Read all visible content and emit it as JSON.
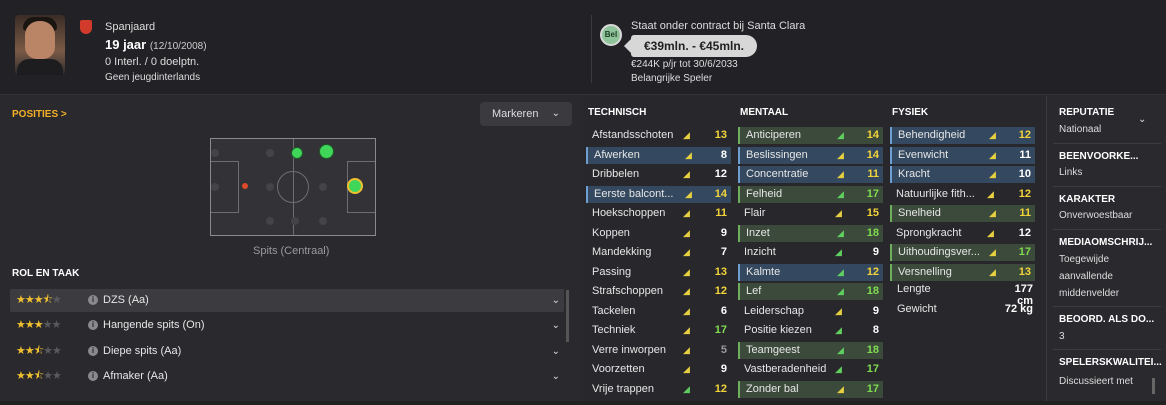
{
  "header": {
    "nationality": "Spanjaard",
    "age": "19 jaar",
    "dob": "(12/10/2008)",
    "caps": "0 Interl. / 0 doelptn.",
    "youth": "Geen jeugdinterlands",
    "contract": "Staat onder contract bij Santa Clara",
    "club_badge": "Bel",
    "value": "€39mln. - €45mln.",
    "wage": "€244K p/jr tot 30/6/2033",
    "squad_role": "Belangrijke Speler"
  },
  "positions": {
    "title": "POSITIES >",
    "mark_button": "Markeren",
    "pitch_label": "Spits (Centraal)"
  },
  "roles": {
    "title": "ROL EN TAAK",
    "items": [
      {
        "name": "DZS (Aa)",
        "stars": "3.5"
      },
      {
        "name": "Hangende spits (On)",
        "stars": "3"
      },
      {
        "name": "Diepe spits (Aa)",
        "stars": "2.5"
      },
      {
        "name": "Afmaker (Aa)",
        "stars": "2.5"
      }
    ]
  },
  "technical": {
    "title": "TECHNISCH",
    "rows": [
      {
        "n": "Afstandsschoten",
        "v": "13"
      },
      {
        "n": "Afwerken",
        "v": "8"
      },
      {
        "n": "Dribbelen",
        "v": "12"
      },
      {
        "n": "Eerste balcont...",
        "v": "14"
      },
      {
        "n": "Hoekschoppen",
        "v": "11"
      },
      {
        "n": "Koppen",
        "v": "9"
      },
      {
        "n": "Mandekking",
        "v": "7"
      },
      {
        "n": "Passing",
        "v": "13"
      },
      {
        "n": "Strafschoppen",
        "v": "12"
      },
      {
        "n": "Tackelen",
        "v": "6"
      },
      {
        "n": "Techniek",
        "v": "17"
      },
      {
        "n": "Verre inworpen",
        "v": "5"
      },
      {
        "n": "Voorzetten",
        "v": "9"
      },
      {
        "n": "Vrije trappen",
        "v": "12"
      }
    ]
  },
  "mental": {
    "title": "MENTAAL",
    "rows": [
      {
        "n": "Anticiperen",
        "v": "14"
      },
      {
        "n": "Beslissingen",
        "v": "14"
      },
      {
        "n": "Concentratie",
        "v": "11"
      },
      {
        "n": "Felheid",
        "v": "17"
      },
      {
        "n": "Flair",
        "v": "15"
      },
      {
        "n": "Inzet",
        "v": "18"
      },
      {
        "n": "Inzicht",
        "v": "9"
      },
      {
        "n": "Kalmte",
        "v": "12"
      },
      {
        "n": "Lef",
        "v": "18"
      },
      {
        "n": "Leiderschap",
        "v": "9"
      },
      {
        "n": "Positie kiezen",
        "v": "8"
      },
      {
        "n": "Teamgeest",
        "v": "18"
      },
      {
        "n": "Vastberadenheid",
        "v": "17"
      },
      {
        "n": "Zonder bal",
        "v": "17"
      }
    ]
  },
  "physical": {
    "title": "FYSIEK",
    "rows": [
      {
        "n": "Behendigheid",
        "v": "12"
      },
      {
        "n": "Evenwicht",
        "v": "11"
      },
      {
        "n": "Kracht",
        "v": "10"
      },
      {
        "n": "Natuurlijke fith...",
        "v": "12"
      },
      {
        "n": "Snelheid",
        "v": "11"
      },
      {
        "n": "Sprongkracht",
        "v": "12"
      },
      {
        "n": "Uithoudingsver...",
        "v": "17"
      },
      {
        "n": "Versnelling",
        "v": "13"
      }
    ],
    "height_label": "Lengte",
    "height": "177 cm",
    "weight_label": "Gewicht",
    "weight": "72 kg"
  },
  "side": {
    "reputation_t": "REPUTATIE",
    "reputation_v": "Nationaal",
    "foot_t": "BEENVOORKE...",
    "foot_v": "Links",
    "char_t": "KARAKTER",
    "char_v": "Onverwoestbaar",
    "media_t": "MEDIAOMSCHRIJ...",
    "media_v1": "Toegewijde",
    "media_v2": "aanvallende",
    "media_v3": "middenvelder",
    "rating_t": "BEOORD. ALS DO...",
    "rating_v": "3",
    "quality_t": "SPELERSKWALITEI...",
    "quality_v": "Discussieert met"
  },
  "colors": {
    "accent": "#f5b025",
    "blue_row": "#34495f",
    "green_row": "#3c4a3c",
    "value_yellow": "#f2d43a",
    "value_green": "#7fdc4f"
  }
}
